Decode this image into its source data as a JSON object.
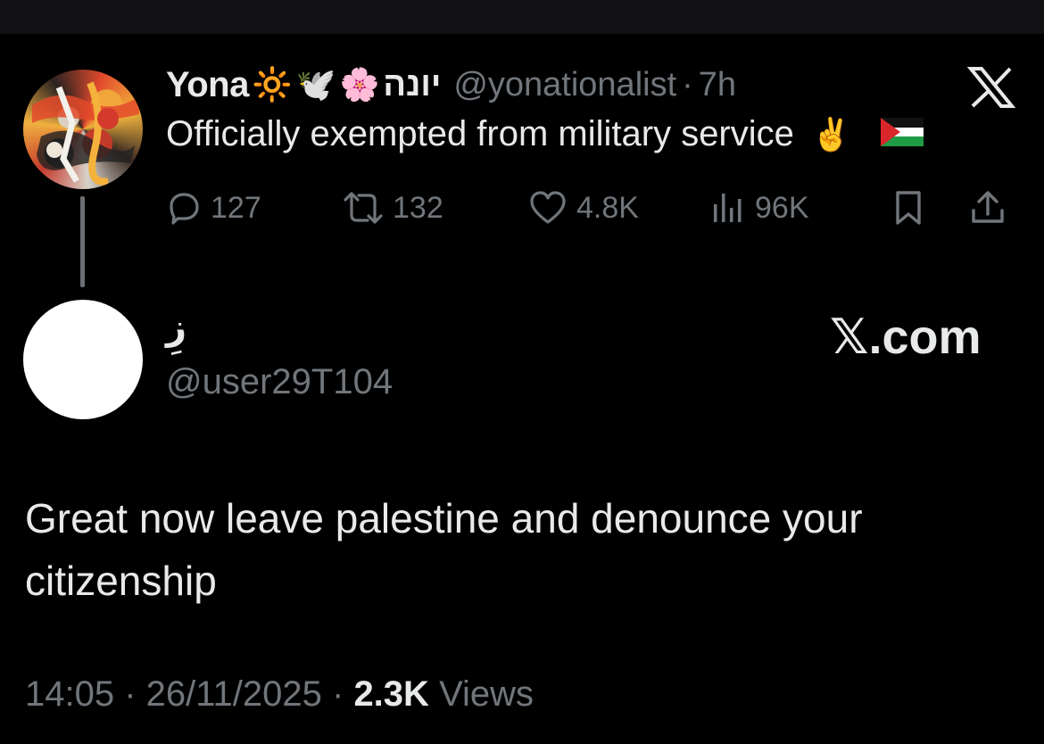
{
  "quoted_tweet": {
    "author_name": "Yona",
    "name_emojis": [
      "🔆",
      "🕊️",
      "🌸"
    ],
    "author_name_hebrew": "יונה",
    "handle": "@yonationalist",
    "separator": "·",
    "time_ago": "7h",
    "text": "Officially exempted from military service",
    "text_emoji": "✌️",
    "flag": "palestine-flag",
    "stats": {
      "replies": "127",
      "reposts": "132",
      "likes": "4.8K",
      "views": "96K"
    },
    "platform_logo": "x-logo-icon"
  },
  "reply_tweet": {
    "author_name": "زِ",
    "handle": "@user29T104",
    "watermark": "𝕏.com",
    "text": "Great now leave palestine and denounce your citizenship",
    "timestamp": "14:05 · 26/11/2025 ·",
    "views_count": "2.3K",
    "views_label": "Views"
  },
  "colors": {
    "background": "#000000",
    "text_primary": "#e7e9ea",
    "text_secondary": "#71767b",
    "thread_line": "#6b6f73"
  }
}
